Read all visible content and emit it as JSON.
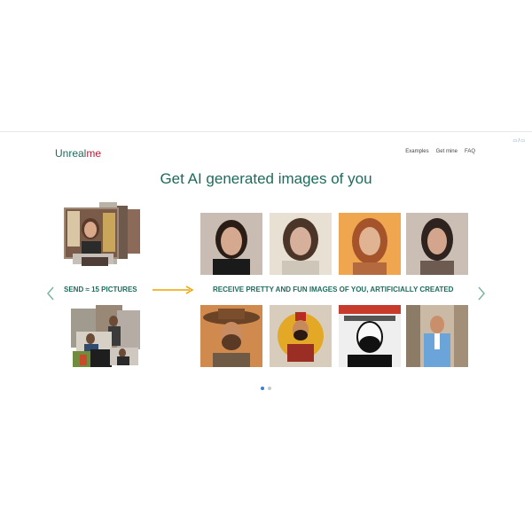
{
  "brand": {
    "logo_main": "Unreal",
    "logo_accent": "me"
  },
  "nav": {
    "items": [
      "Examples",
      "Get mine",
      "FAQ"
    ]
  },
  "lang": "▭ / ▭",
  "headline": "Get AI generated images of you",
  "left_label": "SEND ≈ 15 PICTURES",
  "right_label": "RECEIVE PRETTY AND FUN IMAGES OF YOU, ARTIFICIALLY CREATED",
  "colors": {
    "brand_green": "#1d6b5c",
    "brand_red": "#b5213b",
    "arrow_orange": "#f0a300"
  },
  "carousel": {
    "pages": 2,
    "active": 1
  },
  "output_images": [
    {
      "name": "portrait-woman-1-icon"
    },
    {
      "name": "portrait-woman-2-icon"
    },
    {
      "name": "portrait-woman-3-icon"
    },
    {
      "name": "portrait-woman-4-icon"
    },
    {
      "name": "portrait-cowboy-icon"
    },
    {
      "name": "portrait-king-icon"
    },
    {
      "name": "portrait-comic-icon"
    },
    {
      "name": "portrait-suit-icon"
    }
  ]
}
